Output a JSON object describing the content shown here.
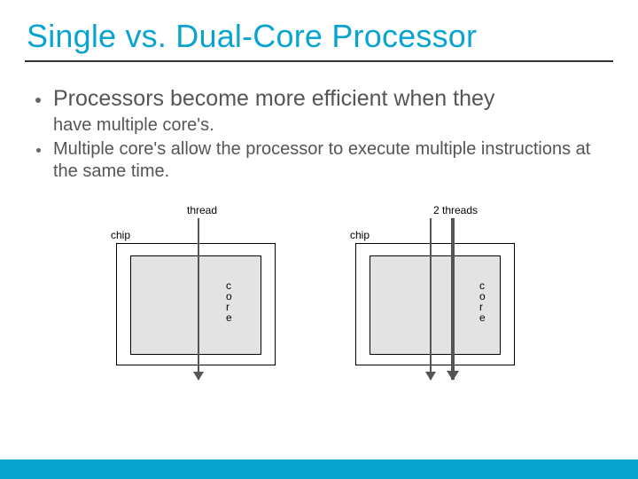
{
  "title": "Single vs. Dual-Core Processor",
  "bullets": {
    "b1_line1": "Processors become more efficient when they",
    "b1_cont": "have multiple core's.",
    "b2": "Multiple core's allow the processor to execute multiple instructions at the same time."
  },
  "diagram": {
    "left": {
      "topLabel": "thread",
      "chipLabel": "chip",
      "core_c": "c",
      "core_o": "o",
      "core_r": "r",
      "core_e": "e"
    },
    "right": {
      "topLabel": "2 threads",
      "chipLabel": "chip",
      "core_c": "c",
      "core_o": "o",
      "core_r": "r",
      "core_e": "e"
    }
  }
}
